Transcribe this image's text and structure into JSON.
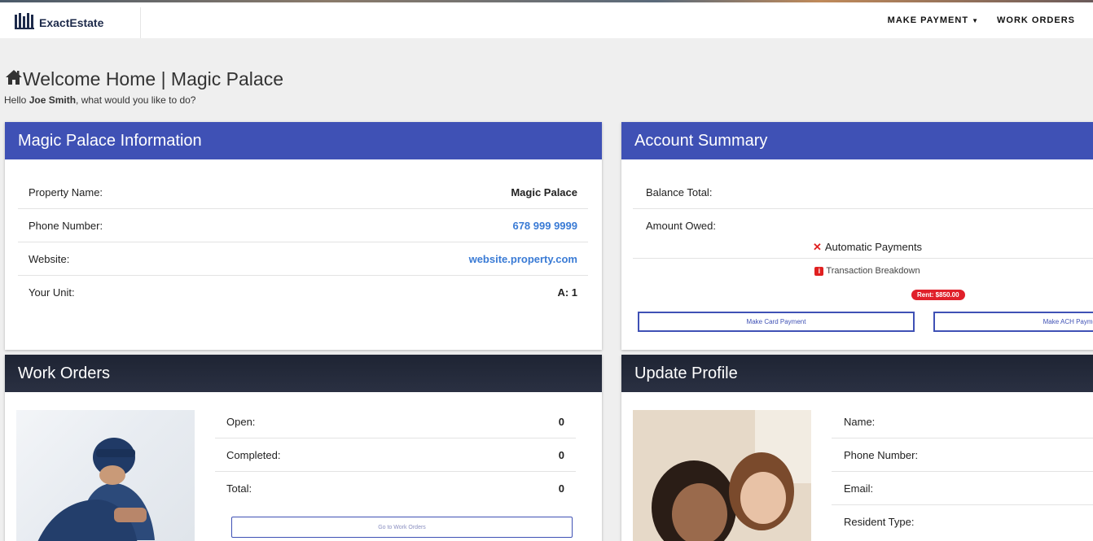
{
  "nav": {
    "brand": "ExactEstate",
    "logo_icon": "building-columns-icon",
    "links": [
      {
        "label": "MAKE PAYMENT",
        "has_caret": true
      },
      {
        "label": "WORK ORDERS",
        "has_caret": false
      }
    ]
  },
  "header": {
    "title": "Welcome Home | Magic Palace",
    "hello_prefix": "Hello ",
    "user_name": "Joe Smith",
    "hello_suffix": ", what would you like to do?"
  },
  "property_panel": {
    "title": "Magic Palace Information",
    "rows": [
      {
        "label": "Property Name:",
        "value": "Magic Palace"
      },
      {
        "label": "Phone Number:",
        "value": "678 999 9999"
      },
      {
        "label": "Website:",
        "value": "website.property.com"
      },
      {
        "label": "Your Unit:",
        "value": "A: 1"
      }
    ]
  },
  "account_panel": {
    "title": "Account Summary",
    "rows": [
      {
        "label": "Balance Total:",
        "value": ""
      },
      {
        "label": "Amount Owed:",
        "value": ""
      }
    ],
    "auto_payments": "Automatic Payments",
    "transaction_breakdown": "Transaction Breakdown",
    "rent_badge": "Rent: $850.00",
    "card_button": "Make Card Payment",
    "ach_button": "Make ACH Payme"
  },
  "work_orders_panel": {
    "title": "Work Orders",
    "rows": [
      {
        "label": "Open:",
        "value": "0"
      },
      {
        "label": "Completed:",
        "value": "0"
      },
      {
        "label": "Total:",
        "value": "0"
      }
    ],
    "button": "Go to Work Orders"
  },
  "profile_panel": {
    "title": "Update Profile",
    "rows": [
      {
        "label": "Name:"
      },
      {
        "label": "Phone Number:"
      },
      {
        "label": "Email:"
      },
      {
        "label": "Resident Type:"
      }
    ]
  },
  "colors": {
    "primary_blue": "#3f51b5",
    "dark_header": "#1e2433",
    "link": "#3a7bd5",
    "danger": "#e02020"
  }
}
